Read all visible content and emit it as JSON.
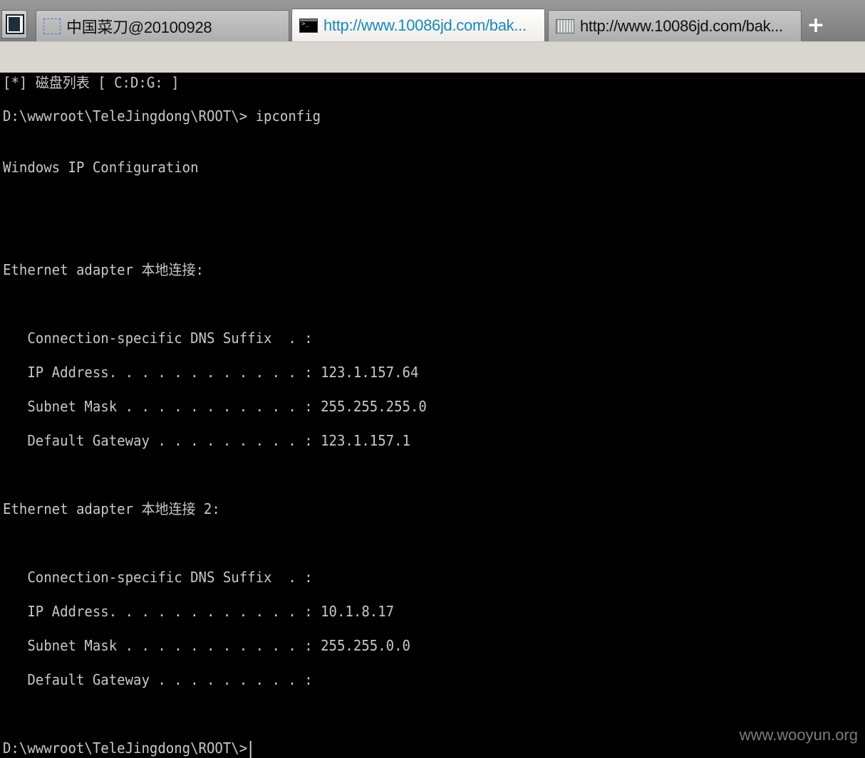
{
  "tabs": [
    {
      "title": "中国菜刀@20100928",
      "icon": "page-icon",
      "active": false
    },
    {
      "title": "http://www.10086jd.com/bak...",
      "icon": "console-icon",
      "active": true
    },
    {
      "title": "http://www.10086jd.com/bak...",
      "icon": "file-grid-icon",
      "active": false
    }
  ],
  "new_tab_label": "+",
  "console": {
    "lines": [
      "[*] 磁盘列表 [ C:D:G: ]",
      "D:\\wwwroot\\TeleJingdong\\ROOT\\> ipconfig",
      "Windows IP Configuration",
      "Ethernet adapter 本地连接:",
      "   Connection-specific DNS Suffix  . :",
      "   IP Address. . . . . . . . . . . . : 123.1.157.64",
      "   Subnet Mask . . . . . . . . . . . : 255.255.255.0",
      "   Default Gateway . . . . . . . . . : 123.1.157.1",
      "Ethernet adapter 本地连接 2:",
      "   Connection-specific DNS Suffix  . :",
      "   IP Address. . . . . . . . . . . . : 10.1.8.17",
      "   Subnet Mask . . . . . . . . . . . : 255.255.0.0",
      "   Default Gateway . . . . . . . . . :",
      "D:\\wwwroot\\TeleJingdong\\ROOT\\>"
    ]
  },
  "watermark": "www.wooyun.org"
}
